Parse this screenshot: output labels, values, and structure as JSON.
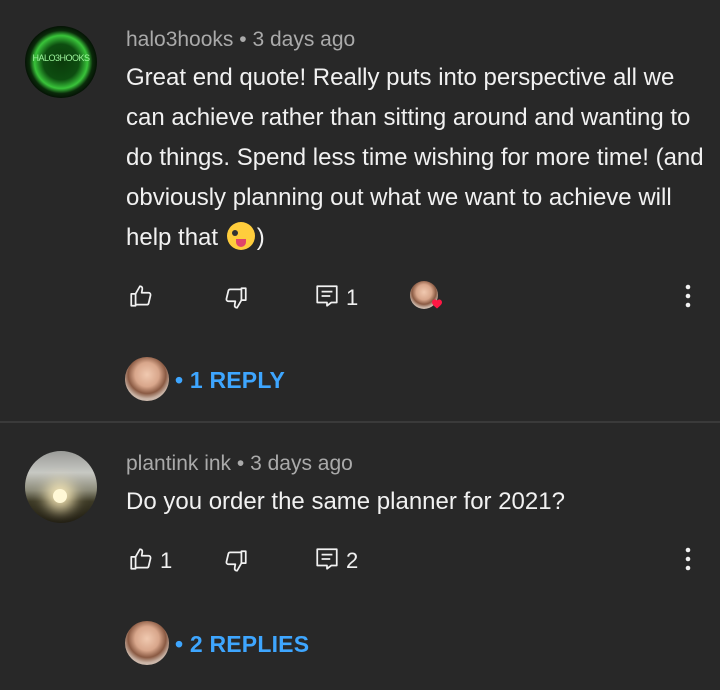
{
  "comments": [
    {
      "avatar_text": "HALO3HOOKS",
      "author": "halo3hooks",
      "time": "3 days ago",
      "text": "Great end quote! Really puts into perspective all we can achieve rather than sitting around and wanting to do things. Spend less time wishing for more time! (and obviously planning out what we want to achieve will help that",
      "text_end": ")",
      "emoji": "winking-face-with-tongue-emoji",
      "likes": "",
      "reply_count": "1",
      "hearted": true,
      "replies_label": "1 REPLY"
    },
    {
      "author": "plantink ink",
      "time": "3 days ago",
      "text": "Do you order the same planner for 2021?",
      "likes": "1",
      "reply_count": "2",
      "hearted": false,
      "replies_label": "2 REPLIES"
    }
  ],
  "meta_separator": " • ",
  "replies_bullet": "•",
  "colors": {
    "background": "#282828",
    "link": "#3ea6ff",
    "meta": "#aaaaaa",
    "text": "#f1f1f1",
    "heart": "#ff1744"
  }
}
